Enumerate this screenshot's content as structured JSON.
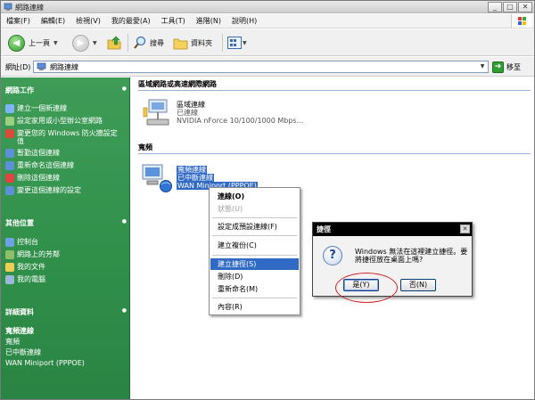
{
  "window": {
    "title": "網路連線",
    "controls": [
      "_",
      "□",
      "✕"
    ]
  },
  "menu": [
    "檔案(F)",
    "編輯(E)",
    "檢視(V)",
    "我的最愛(A)",
    "工具(T)",
    "進階(N)",
    "說明(H)"
  ],
  "toolbar": {
    "back": "上一頁",
    "search": "搜尋",
    "folders": "資料夾"
  },
  "address": {
    "label": "網址(D)",
    "value": "網路連線",
    "go": "移至"
  },
  "sidebar": {
    "network_tasks": {
      "heading": "網路工作",
      "items": [
        "建立一個新連線",
        "設定家用或小型辦公室網路",
        "變更您的 Windows 防火牆設定值",
        "暫勤這個連線",
        "重新命名這個連線",
        "刪除這個連線",
        "變更這個連線的設定"
      ]
    },
    "other_places": {
      "heading": "其他位置",
      "items": [
        "控制台",
        "網路上的芳鄰",
        "我的文件",
        "我的電腦"
      ]
    },
    "details": {
      "heading": "詳細資料",
      "title": "寬頻連線",
      "lines": [
        "寬頻",
        "已中斷連線",
        "WAN Miniport (PPPOE)"
      ]
    }
  },
  "content": {
    "lan_group": "區域網路或高速網際網路",
    "lan_conn": {
      "name": "區域連線",
      "status": "已連線",
      "device": "NVIDIA nForce 10/100/1000 Mbps..."
    },
    "broadband_group": "寬頻",
    "broadband_conn": {
      "name": "寬頻連線",
      "status": "已中斷連線",
      "device": "WAN Miniport (PPPOE)"
    }
  },
  "context_menu": {
    "items": [
      "連線(O)",
      "狀態(U)",
      "設定成預設連線(F)",
      "建立複份(C)",
      "建立捷徑(S)",
      "刪除(D)",
      "重新命名(M)",
      "內容(R)"
    ]
  },
  "dialog": {
    "title": "捷徑",
    "message": "Windows 無法在這裡建立捷徑。要將捷徑放在桌面上嗎?",
    "yes": "是(Y)",
    "no": "否(N)"
  },
  "colors": {
    "sidebar_green": "#2f8f49",
    "selection_blue": "#316ac5",
    "annotation_red": "#cc2222"
  }
}
